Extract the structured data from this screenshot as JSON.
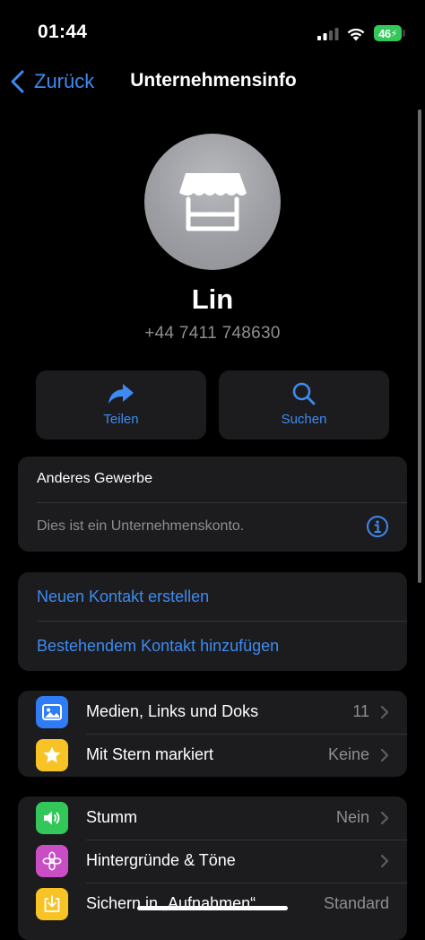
{
  "status_bar": {
    "time": "01:44",
    "battery": "46"
  },
  "nav": {
    "back_label": "Zurück",
    "title": "Unternehmensinfo"
  },
  "profile": {
    "name": "Lin",
    "phone": "+44 7411 748630",
    "avatar_icon": "storefront-icon"
  },
  "actions": [
    {
      "label": "Teilen",
      "icon": "share-arrow-icon"
    },
    {
      "label": "Suchen",
      "icon": "search-icon"
    }
  ],
  "business": {
    "category": "Anderes Gewerbe",
    "description": "Dies ist ein Unternehmenskonto.",
    "info_icon": "info-icon"
  },
  "contact_links": {
    "create": "Neuen Kontakt erstellen",
    "add_existing": "Bestehendem Kontakt hinzufügen"
  },
  "media_group": [
    {
      "label": "Medien, Links und Doks",
      "value": "11",
      "icon": "photo-icon",
      "color": "#2f7cf6"
    },
    {
      "label": "Mit Stern markiert",
      "value": "Keine",
      "icon": "star-icon",
      "color": "#f7c325"
    }
  ],
  "settings_group": [
    {
      "label": "Stumm",
      "value": "Nein",
      "icon": "speaker-icon",
      "color": "#33c659"
    },
    {
      "label": "Hintergründe & Töne",
      "value": "",
      "icon": "flower-icon",
      "color": "#c94ec5"
    },
    {
      "label": "Sichern in „Aufnahmen“",
      "value": "Standard",
      "icon": "save-download-icon",
      "color": "#f7c325"
    }
  ],
  "colors": {
    "accent": "#3d8bf2",
    "card": "#1c1c1e",
    "background": "#000000",
    "secondary_text": "#8e8e93"
  }
}
